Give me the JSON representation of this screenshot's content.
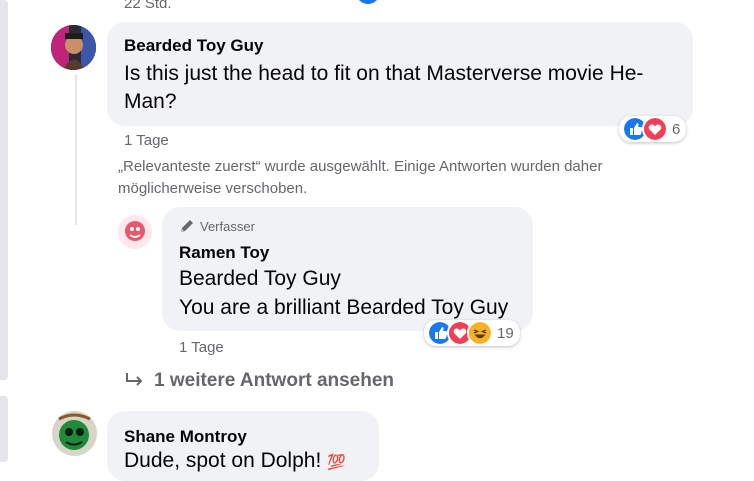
{
  "top": {
    "time_label": "22 Std."
  },
  "comment1": {
    "author": "Bearded Toy Guy",
    "text": "Is this just the head to fit on that Masterverse movie He-Man?",
    "time": "1 Tage",
    "reactions_count": "6",
    "icons": [
      "like-icon",
      "love-icon"
    ]
  },
  "notice": {
    "text": "„Relevanteste zuerst“ wurde ausgewählt. Einige Antworten wurden daher möglicherweise verschoben."
  },
  "reply1": {
    "badge": "Verfasser",
    "author": "Ramen Toy",
    "line1": "Bearded Toy Guy",
    "line2": "You are a brilliant Bearded Toy Guy",
    "time": "1 Tage",
    "reactions_count": "19",
    "icons": [
      "like-icon",
      "love-icon",
      "haha-icon"
    ]
  },
  "more_replies": {
    "label": "1 weitere Antwort ansehen"
  },
  "comment2": {
    "author": "Shane Montroy",
    "text": "Dude, spot on Dolph!",
    "emoji": "💯"
  },
  "colors": {
    "like_blue": "#1877f2",
    "love_red": "#f33e58",
    "haha_yellow": "#f7b125"
  }
}
